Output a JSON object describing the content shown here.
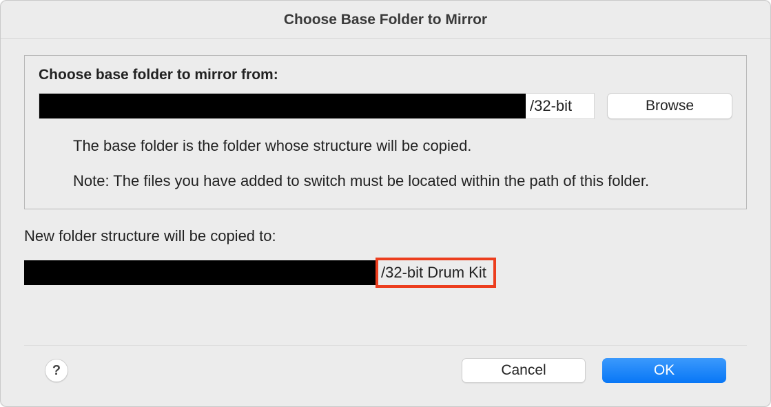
{
  "dialog": {
    "title": "Choose Base Folder to Mirror"
  },
  "group": {
    "label": "Choose base folder to mirror from:",
    "path_visible_suffix": "/32-bit",
    "browse_label": "Browse",
    "description1": "The base folder is the folder whose structure will be copied.",
    "description2": "Note: The files you have added to switch must be located within the path of this folder."
  },
  "destination": {
    "label": "New folder structure will be copied to:",
    "path_visible_suffix": "/32-bit Drum Kit"
  },
  "footer": {
    "help_label": "?",
    "cancel_label": "Cancel",
    "ok_label": "OK"
  }
}
